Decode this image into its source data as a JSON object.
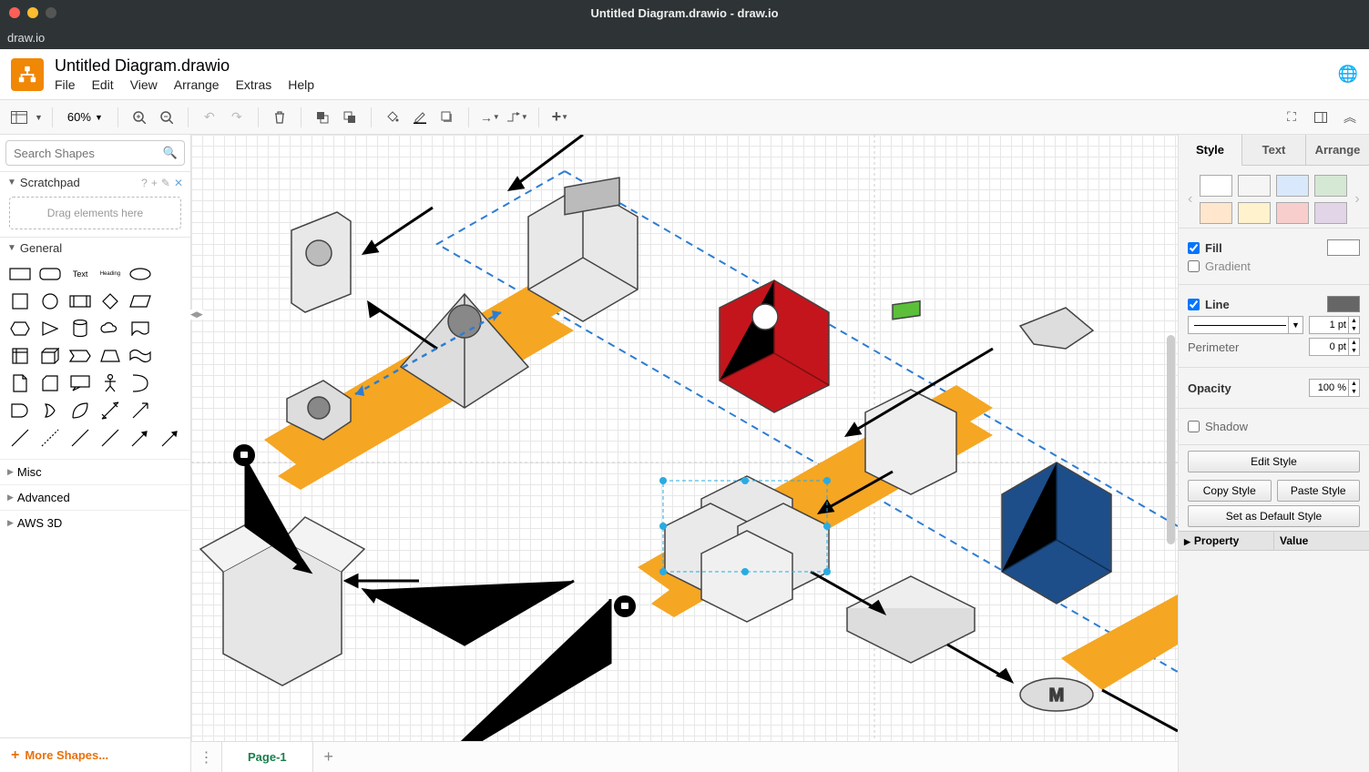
{
  "window": {
    "mac_title": "Untitled Diagram.drawio - draw.io",
    "mac_menu": "draw.io"
  },
  "doc": {
    "title": "Untitled Diagram.drawio",
    "menus": [
      "File",
      "Edit",
      "View",
      "Arrange",
      "Extras",
      "Help"
    ]
  },
  "toolbar": {
    "zoom": "60%"
  },
  "left": {
    "search_placeholder": "Search Shapes",
    "scratchpad": "Scratchpad",
    "drag_hint": "Drag elements here",
    "general": "General",
    "text_label": "Text",
    "heading_label": "Heading",
    "categories": [
      "Misc",
      "Advanced",
      "AWS 3D"
    ],
    "more_shapes": "More Shapes..."
  },
  "right": {
    "tabs": [
      "Style",
      "Text",
      "Arrange"
    ],
    "swatches_a": [
      "#ffffff",
      "#f5f5f5",
      "#dae8fc",
      "#d5e8d4"
    ],
    "swatches_b": [
      "#ffe6cc",
      "#fff2cc",
      "#f8cecc",
      "#e1d5e7"
    ],
    "fill": "Fill",
    "gradient": "Gradient",
    "line": "Line",
    "line_width": "1 pt",
    "perimeter": "Perimeter",
    "perimeter_val": "0 pt",
    "opacity": "Opacity",
    "opacity_val": "100 %",
    "shadow": "Shadow",
    "edit_style": "Edit Style",
    "copy_style": "Copy Style",
    "paste_style": "Paste Style",
    "set_default": "Set as Default Style",
    "property": "Property",
    "value": "Value"
  },
  "footer": {
    "page": "Page-1"
  }
}
